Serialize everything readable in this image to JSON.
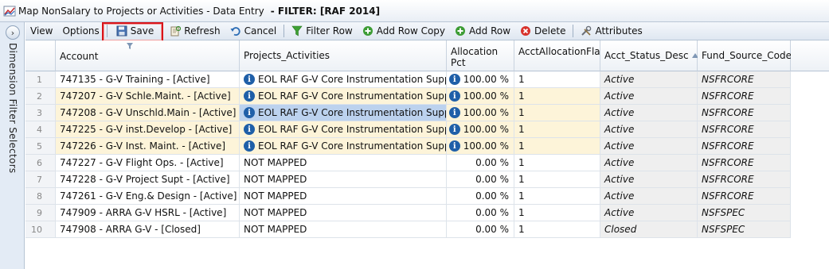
{
  "window": {
    "title": "Map NonSalary to Projects or Activities - Data Entry",
    "filter": "- FILTER: [RAF 2014]"
  },
  "toolbar": {
    "view": "View",
    "options": "Options",
    "save": "Save",
    "refresh": "Refresh",
    "cancel": "Cancel",
    "filter_row": "Filter Row",
    "add_row_copy": "Add Row Copy",
    "add_row": "Add Row",
    "delete": "Delete",
    "attributes": "Attributes"
  },
  "side_panel": {
    "label": "Dimension Filter Selectors",
    "toggle_glyph": "›"
  },
  "grid": {
    "columns": [
      "Account",
      "Projects_Activities",
      "Allocation Pct",
      "AcctAllocationFlag",
      "Acct_Status_Desc",
      "Fund_Source_Code"
    ],
    "rows": [
      {
        "n": "1",
        "account": "747135 - G-V Training - [Active]",
        "project": "EOL RAF G-V Core Instrumentation Suppo",
        "pct": "100.00 %",
        "flag": "1",
        "status": "Active",
        "fund": "NSFRCORE"
      },
      {
        "n": "2",
        "account": "747207 - G-V Schle.Maint. - [Active]",
        "project": "EOL RAF G-V Core Instrumentation Suppo",
        "pct": "100.00 %",
        "flag": "1",
        "status": "Active",
        "fund": "NSFRCORE"
      },
      {
        "n": "3",
        "account": "747208 - G-V Unschld.Main - [Active]",
        "project": "EOL RAF G-V Core Instrumentation Suppo",
        "pct": "100.00 %",
        "flag": "1",
        "status": "Active",
        "fund": "NSFRCORE"
      },
      {
        "n": "4",
        "account": "747225 - G-V inst.Develop - [Active]",
        "project": "EOL RAF G-V Core Instrumentation Suppo",
        "pct": "100.00 %",
        "flag": "1",
        "status": "Active",
        "fund": "NSFRCORE"
      },
      {
        "n": "5",
        "account": "747226 - G-V Inst. Maint. - [Active]",
        "project": "EOL RAF G-V Core Instrumentation Suppo",
        "pct": "100.00 %",
        "flag": "1",
        "status": "Active",
        "fund": "NSFRCORE"
      },
      {
        "n": "6",
        "account": "747227 - G-V Flight Ops. - [Active]",
        "project": "NOT MAPPED",
        "pct": "0.00 %",
        "flag": "1",
        "status": "Active",
        "fund": "NSFRCORE"
      },
      {
        "n": "7",
        "account": "747228 - G-V Project Supt - [Active]",
        "project": "NOT MAPPED",
        "pct": "0.00 %",
        "flag": "1",
        "status": "Active",
        "fund": "NSFRCORE"
      },
      {
        "n": "8",
        "account": "747261 - G-V Eng.& Design - [Active]",
        "project": "NOT MAPPED",
        "pct": "0.00 %",
        "flag": "1",
        "status": "Active",
        "fund": "NSFRCORE"
      },
      {
        "n": "9",
        "account": "747909 - ARRA G-V HSRL - [Active]",
        "project": "NOT MAPPED",
        "pct": "0.00 %",
        "flag": "1",
        "status": "Active",
        "fund": "NSFSPEC"
      },
      {
        "n": "10",
        "account": "747908 - ARRA G-V - [Closed]",
        "project": "NOT MAPPED",
        "pct": "0.00 %",
        "flag": "1",
        "status": "Closed",
        "fund": "NSFSPEC"
      }
    ],
    "info_glyph": "i"
  }
}
